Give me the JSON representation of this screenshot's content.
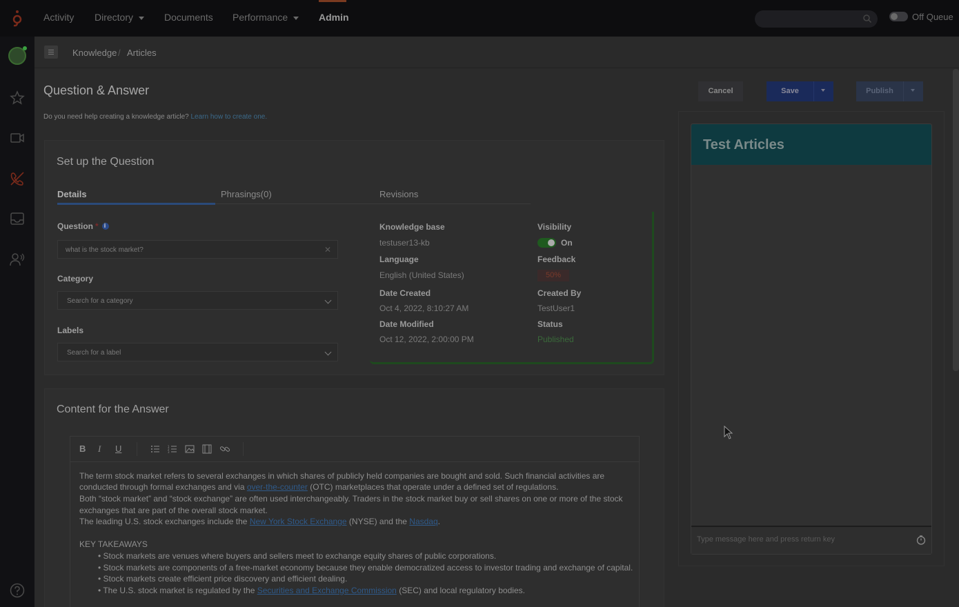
{
  "nav": {
    "items": [
      {
        "label": "Activity"
      },
      {
        "label": "Directory"
      },
      {
        "label": "Documents"
      },
      {
        "label": "Performance"
      },
      {
        "label": "Admin"
      }
    ],
    "queue_label": "Off Queue"
  },
  "breadcrumb": {
    "items": [
      "Knowledge",
      "Articles"
    ],
    "separator": "/"
  },
  "page": {
    "title": "Question & Answer",
    "help_prefix": "Do you need help creating a knowledge article?",
    "help_link": "Learn how to create one."
  },
  "question_section": {
    "title": "Set up the Question",
    "tabs": [
      "Details",
      "Phrasings(0)",
      "Revisions"
    ],
    "question_label": "Question",
    "required_mark": "*",
    "question_value": "what is the stock market?",
    "category_label": "Category",
    "category_placeholder": "Search for a category",
    "labels_label": "Labels",
    "labels_placeholder": "Search for a label"
  },
  "meta": {
    "knowledge_base_label": "Knowledge base",
    "knowledge_base_value": "testuser13-kb",
    "language_label": "Language",
    "language_value": "English (United States)",
    "date_created_label": "Date Created",
    "date_created_value": "Oct 4, 2022, 8:10:27 AM",
    "date_modified_label": "Date Modified",
    "date_modified_value": "Oct 12, 2022, 2:00:00 PM",
    "visibility_label": "Visibility",
    "visibility_value": "On",
    "feedback_label": "Feedback",
    "feedback_value": "50%",
    "created_by_label": "Created By",
    "created_by_value": "TestUser1",
    "status_label": "Status",
    "status_value": "Published"
  },
  "answer_section": {
    "title": "Content for the Answer",
    "toolbar": [
      "B",
      "I",
      "U"
    ],
    "p1a": "The term stock market refers to several exchanges in which shares of publicly held companies are bought and sold. Such financial activities are",
    "p1b_pre": "conducted through formal exchanges and via ",
    "p1b_link": "over-the-counter",
    "p1b_post": " (OTC) marketplaces that operate under a defined set of regulations.",
    "p2a": "Both “stock market” and “stock exchange” are often used interchangeably. Traders in the stock market buy or sell shares on one or more of the stock",
    "p2b": "exchanges that are part of the overall stock market.",
    "p3_pre": "The leading U.S. stock exchanges include the ",
    "p3_link1": "New York Stock Exchange",
    "p3_mid": " (NYSE) and the ",
    "p3_link2": "Nasdaq",
    "p3_post": ".",
    "takeaways_title": "KEY TAKEAWAYS",
    "b1": "• Stock markets are venues where buyers and sellers meet to exchange equity shares of public corporations.",
    "b2": "• Stock markets are components of a free-market economy because they enable democratized access to investor trading and exchange of capital.",
    "b3": "• Stock markets create efficient price discovery and efficient dealing.",
    "b4_pre": "• The U.S. stock market is regulated by the ",
    "b4_link": "Securities and Exchange Commission",
    "b4_post": " (SEC) and local regulatory bodies."
  },
  "actions": {
    "cancel": "Cancel",
    "save": "Save",
    "publish": "Publish"
  },
  "chat": {
    "title": "Test Articles",
    "placeholder": "Type message here and press return key"
  },
  "colors": {
    "accent_blue": "#1a2a5a",
    "chat_header": "#0e3a40",
    "brand": "#c23b22",
    "status_green": "#3a6a3a"
  }
}
